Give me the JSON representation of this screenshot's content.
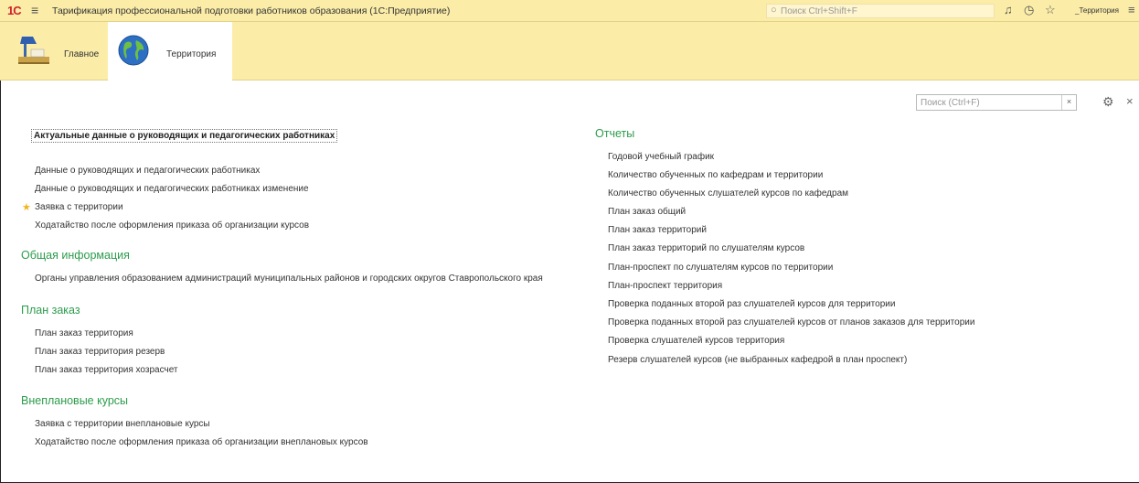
{
  "titlebar": {
    "logo": "1С",
    "title": "Тарификация профессиональной подготовки работников образования (1С:Предприятие)",
    "search_placeholder": "Поиск Ctrl+Shift+F",
    "user": "_Территория"
  },
  "sections": [
    {
      "label": "Главное",
      "icon": "desk-lamp-icon"
    },
    {
      "label": "Территория",
      "icon": "globe-icon"
    }
  ],
  "form": {
    "search_placeholder": "Поиск (Ctrl+F)",
    "clear": "×",
    "close": "×"
  },
  "left": {
    "featured": "Актуальные данные о руководящих и педагогических работниках",
    "items": [
      "Данные о руководящих и педагогических работниках",
      "Данные о руководящих и педагогических работниках изменение",
      "Заявка с территории",
      "Ходатайство после оформления приказа об организации курсов"
    ],
    "groups": [
      {
        "title": "Общая информация",
        "items": [
          "Органы управления образованием администраций муниципальных районов и городских округов Ставропольского края"
        ]
      },
      {
        "title": "План заказ",
        "items": [
          "План заказ территория",
          "План заказ территория резерв",
          "План заказ территория хозрасчет"
        ]
      },
      {
        "title": "Внеплановые курсы",
        "items": [
          "Заявка с территории внеплановые курсы",
          "Ходатайство после оформления приказа об организации внеплановых курсов"
        ]
      }
    ]
  },
  "right": {
    "title": "Отчеты",
    "items": [
      "Годовой учебный график",
      "Количество обученных по кафедрам и территории",
      "Количество обученных слушателей курсов по кафедрам",
      "План заказ общий",
      "План заказ территорий",
      "План заказ территорий по слушателям курсов",
      "План-проспект по слушателям курсов по территории",
      "План-проспект территория",
      "Проверка поданных второй раз слушателей курсов для территории",
      "Проверка поданных второй раз слушателей курсов от планов заказов для территории",
      "Проверка слушателей курсов территория",
      "Резерв слушателей курсов (не выбранных кафедрой в план проспект)"
    ]
  },
  "colors": {
    "panel": "#fbeda8",
    "accent_green": "#2c9c4c",
    "star": "#f2b51d",
    "logo_red": "#d0202a"
  }
}
